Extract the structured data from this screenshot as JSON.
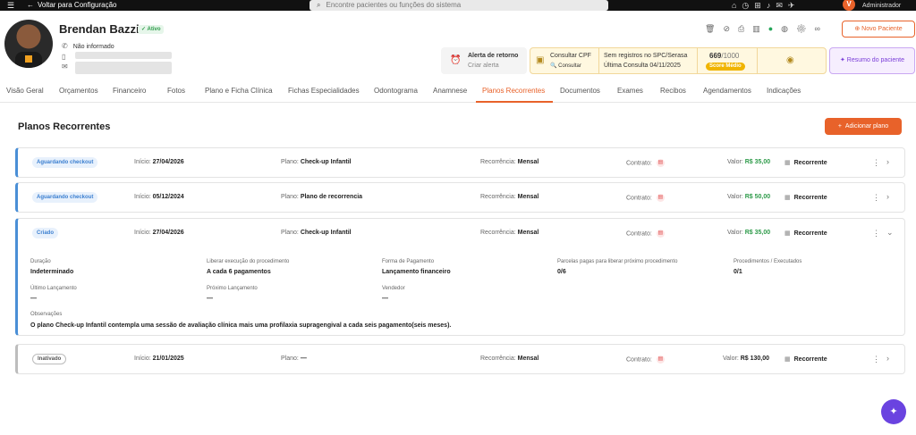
{
  "topbar": {
    "menu_icon": "hamburger-icon",
    "back_label": "Voltar para Configuração",
    "search_placeholder": "Encontre pacientes ou funções do sistema",
    "role": "Administrador",
    "user_initial": "V"
  },
  "patient": {
    "name": "Brendan Bazzi",
    "status": "Ativo",
    "phone": "Não informado"
  },
  "header": {
    "new_patient_label": "Novo Paciente",
    "alert_title": "Alerta de retorno",
    "alert_action": "Criar alerta",
    "cpf_title": "Consultar CPF",
    "cpf_action": "Consultar",
    "spc_status": "Sem registros no SPC/Serasa",
    "last_query": "Última Consulta 04/11/2025",
    "score_value": "669",
    "score_max": "/1000",
    "score_label": "Score Médio",
    "summary_label": "Resumo do paciente"
  },
  "tabs": [
    "Visão Geral",
    "Orçamentos",
    "Financeiro",
    "Fotos",
    "Plano e Ficha Clínica",
    "Fichas Especialidades",
    "Odontograma",
    "Anamnese",
    "Planos Recorrentes",
    "Documentos",
    "Exames",
    "Recibos",
    "Agendamentos",
    "Indicações"
  ],
  "section": {
    "title": "Planos Recorrentes",
    "add_label": "Adicionar plano"
  },
  "labels": {
    "inicio": "Início:",
    "plano": "Plano:",
    "recorrencia": "Recorrência:",
    "contrato": "Contrato:",
    "valor": "Valor:"
  },
  "plans": [
    {
      "status": "Aguardando checkout",
      "inicio": "27/04/2026",
      "plano": "Check-up Infantil",
      "recorrencia": "Mensal",
      "valor": "R$ 35,00",
      "tipo": "Recorrente"
    },
    {
      "status": "Aguardando checkout",
      "inicio": "05/12/2024",
      "plano": "Plano de recorrencia",
      "recorrencia": "Mensal",
      "valor": "R$ 50,00",
      "tipo": "Recorrente"
    },
    {
      "status": "Criado",
      "inicio": "27/04/2026",
      "plano": "Check-up Infantil",
      "recorrencia": "Mensal",
      "valor": "R$ 35,00",
      "tipo": "Recorrente"
    },
    {
      "status": "Inativado",
      "inicio": "21/01/2025",
      "plano": "—",
      "recorrencia": "Mensal",
      "valor": "R$ 130,00",
      "tipo": "Recorrente"
    }
  ],
  "details": {
    "duracao_label": "Duração",
    "duracao": "Indeterminado",
    "liberar_label": "Liberar execução do procedimento",
    "liberar": "A cada 6 pagamentos",
    "forma_label": "Forma de Pagamento",
    "forma": "Lançamento financeiro",
    "parcelas_label": "Parcelas pagas para liberar próximo procedimento",
    "parcelas": "0/6",
    "procedimentos_label": "Procedimentos / Executados",
    "procedimentos": "0/1",
    "ultimo_label": "Último Lançamento",
    "ultimo": "—",
    "proximo_label": "Próximo Lançamento",
    "proximo": "—",
    "vendedor_label": "Vendedor",
    "vendedor": "—",
    "obs_label": "Observações",
    "obs": "O plano Check-up Infantil contempla uma sessão de avaliação clínica mais uma profilaxia supragengival a cada seis pagamento(seis meses)."
  }
}
